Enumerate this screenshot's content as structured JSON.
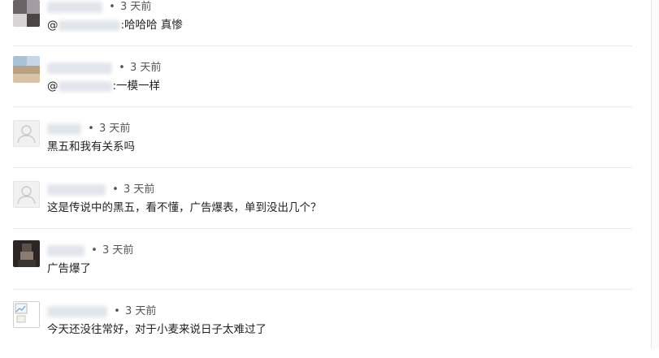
{
  "comments": [
    {
      "author": "",
      "separator": "•",
      "time": "3 天前",
      "reply_to": "@",
      "text": ":哈哈哈 真惨",
      "avatar": {
        "icon": "pixelated-avatar",
        "colors": [
          "#5e5a5c",
          "#9a9396",
          "#d6d2d3",
          "#45403f"
        ]
      }
    },
    {
      "author": "",
      "separator": "•",
      "time": "3 天前",
      "reply_to": "@",
      "text": ":一模一样",
      "avatar": {
        "icon": "pixelated-avatar",
        "colors": [
          "#a8c0d8",
          "#c4d4e4",
          "#b8a085",
          "#d7c2a4"
        ]
      }
    },
    {
      "author": "",
      "separator": "•",
      "time": "3 天前",
      "reply_to": "",
      "text": "黑五和我有关系吗",
      "avatar": {
        "icon": "default-user-icon"
      }
    },
    {
      "author": "",
      "separator": "•",
      "time": "3 天前",
      "reply_to": "",
      "text": "这是传说中的黑五，看不懂，广告爆表，单到没出几个？",
      "avatar": {
        "icon": "default-user-icon"
      }
    },
    {
      "author": "",
      "separator": "•",
      "time": "3 天前",
      "reply_to": "",
      "text": "广告爆了",
      "avatar": {
        "icon": "pixelated-avatar",
        "colors": [
          "#2b2625",
          "#5a4f4b",
          "#8a7a70",
          "#1c1918"
        ]
      }
    },
    {
      "author": "",
      "separator": "•",
      "time": "3 天前",
      "reply_to": "",
      "text": "今天还没往常好，对于小麦来说日子太难过了",
      "avatar": {
        "icon": "broken-image-icon"
      }
    }
  ]
}
